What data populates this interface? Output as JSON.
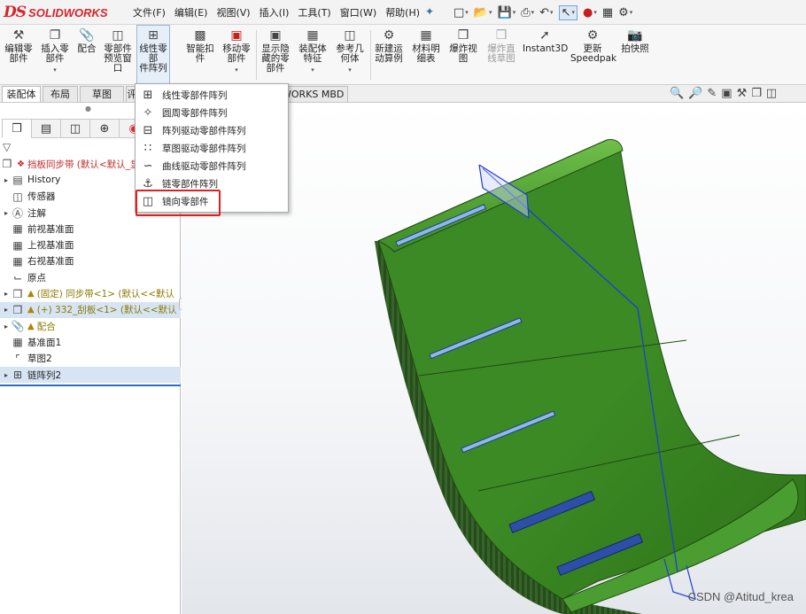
{
  "app": {
    "logo_ds": "DS",
    "logo_name": "SOLIDWORKS"
  },
  "menu": [
    "文件(F)",
    "编辑(E)",
    "视图(V)",
    "插入(I)",
    "工具(T)",
    "窗口(W)",
    "帮助(H)"
  ],
  "ribbon": {
    "edit_component": "编辑零\n部件",
    "insert_component": "插入零\n部件",
    "mate": "配合",
    "component_preview": "零部件\n预览窗\n口",
    "linear_pattern": "线性零部\n件阵列",
    "smart_fasteners": "智能扣\n件",
    "move_component": "移动零\n部件",
    "show_hidden": "显示隐\n藏的零\n部件",
    "assembly_features": "装配体\n特征",
    "reference_geometry": "参考几\n何体",
    "new_motion_study": "新建运\n动算例",
    "bom": "材料明\n细表",
    "exploded_view": "爆炸视\n图",
    "explode_line": "爆炸直\n线草图",
    "instant3d": "Instant3D",
    "update_speedpak": "更新\nSpeedpak",
    "snapshot": "拍快照"
  },
  "tabs": [
    "装配体",
    "布局",
    "草图",
    "评"
  ],
  "mbd_tab": "WORKS MBD",
  "dropdown_items": [
    "线性零部件阵列",
    "圆周零部件阵列",
    "阵列驱动零部件阵列",
    "草图驱动零部件阵列",
    "曲线驱动零部件阵列",
    "链零部件阵列",
    "镜向零部件"
  ],
  "tree": {
    "root": "挡板同步带  (默认<默认_显",
    "history": "History",
    "sensors": "传感器",
    "annotations": "注解",
    "front_plane": "前视基准面",
    "top_plane": "上视基准面",
    "right_plane": "右视基准面",
    "origin": "原点",
    "fixed_part": "(固定) 同步带<1> (默认<<默认",
    "scraper_part": "(+) 332_刮板<1> (默认<<默认",
    "mates": "配合",
    "plane1": "基准面1",
    "sketch2": "草图2",
    "chain_pattern": "链阵列2"
  },
  "watermark": "CSDN @Atitud_krea",
  "colors": {
    "belt_green": "#3f8f27",
    "belt_dark": "#2d6a1a",
    "highlight_red": "#e02020",
    "sketch_blue": "#1f3fd0"
  }
}
